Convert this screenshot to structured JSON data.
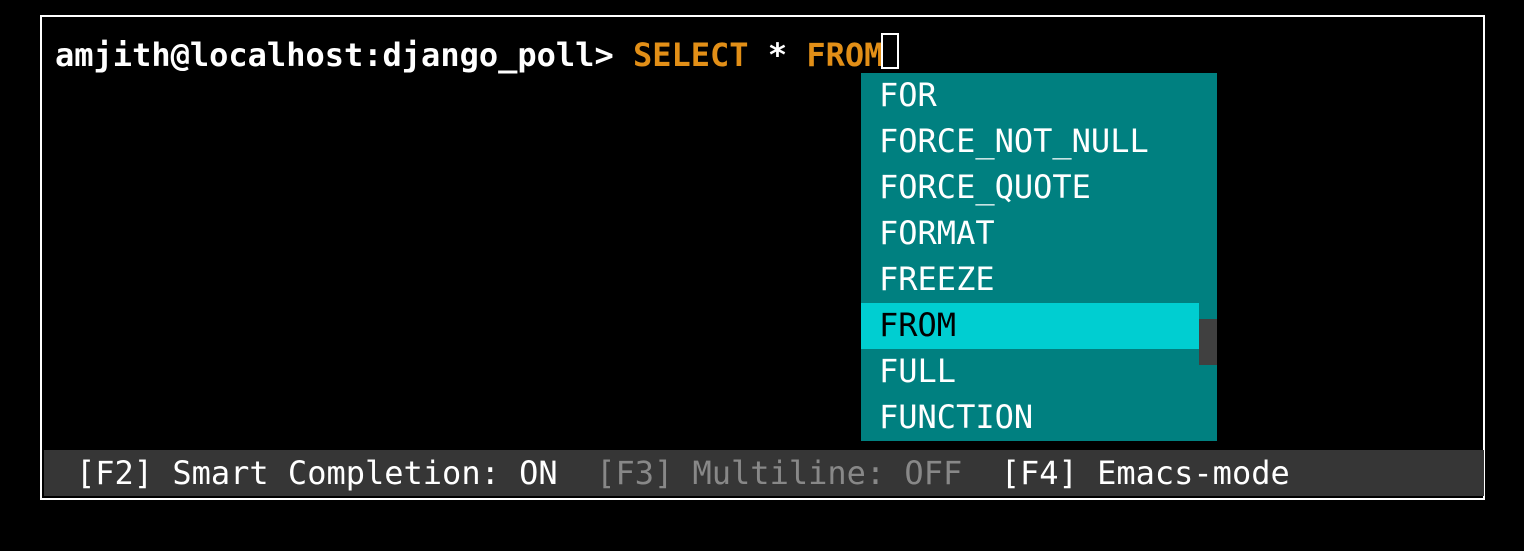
{
  "prompt": {
    "user_host_db": "amjith@localhost:django_poll>",
    "sql": {
      "select": "SELECT",
      "star": "*",
      "from": "FROM"
    }
  },
  "completion": {
    "items": [
      {
        "label": "FOR",
        "selected": false
      },
      {
        "label": "FORCE_NOT_NULL",
        "selected": false
      },
      {
        "label": "FORCE_QUOTE",
        "selected": false
      },
      {
        "label": "FORMAT",
        "selected": false
      },
      {
        "label": "FREEZE",
        "selected": false
      },
      {
        "label": "FROM",
        "selected": true
      },
      {
        "label": "FULL",
        "selected": false
      },
      {
        "label": "FUNCTION",
        "selected": false
      }
    ]
  },
  "status_bar": {
    "f2_key": "[F2]",
    "f2_label": " Smart Completion: ON  ",
    "f3_key": "[F3]",
    "f3_label": " Multiline: OFF  ",
    "f4_key": "[F4]",
    "f4_label": " Emacs-mode"
  }
}
